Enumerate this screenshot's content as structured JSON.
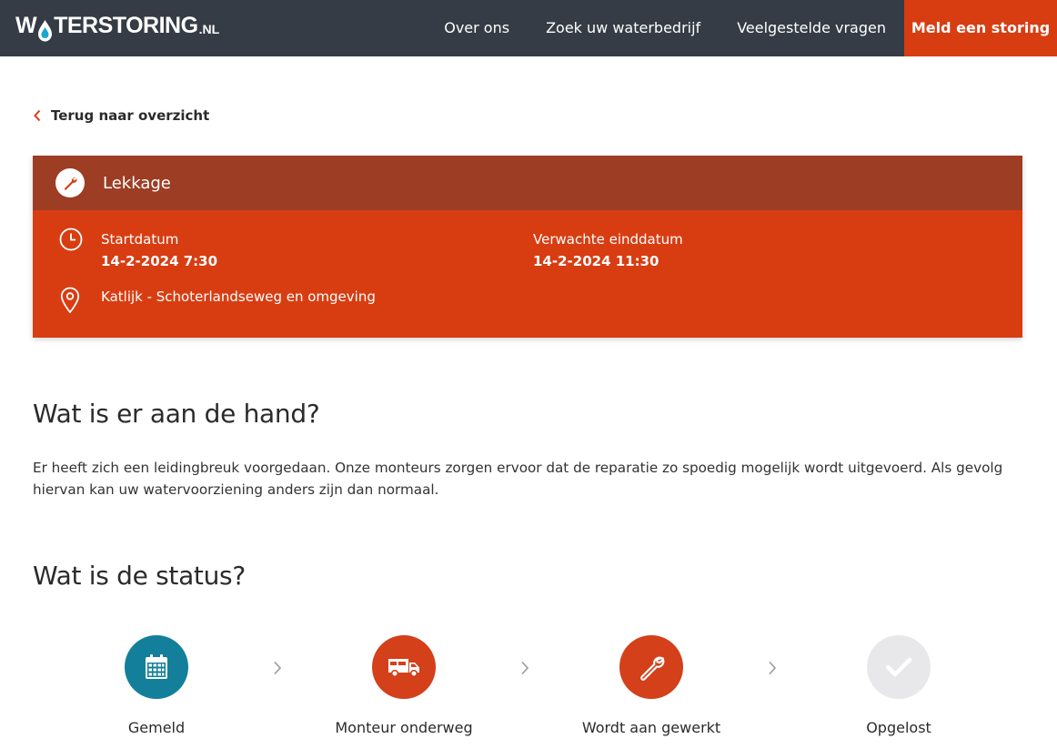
{
  "header": {
    "logo": {
      "part1": "W",
      "part2": "A",
      "part3": "TERSTORING",
      "suffix": ".NL"
    },
    "nav": [
      "Over ons",
      "Zoek uw waterbedrijf",
      "Veelgestelde vragen"
    ],
    "cta": "Meld een storing"
  },
  "back_link": "Terug naar overzicht",
  "incident": {
    "type": "Lekkage",
    "start_label": "Startdatum",
    "start_value": "14-2-2024 7:30",
    "end_label": "Verwachte einddatum",
    "end_value": "14-2-2024 11:30",
    "location": "Katlijk - Schoterlandseweg en omgeving"
  },
  "section1": {
    "heading": "Wat is er aan de hand?",
    "text": "Er heeft zich een leidingbreuk voorgedaan. Onze monteurs zorgen ervoor dat de reparatie zo spoedig mogelijk wordt uitgevoerd. Als gevolg hiervan kan uw watervoorziening anders zijn dan normaal."
  },
  "section2": {
    "heading": "Wat is de status?",
    "steps": [
      {
        "label": "Gemeld",
        "icon": "calendar-icon",
        "color": "#137f9b"
      },
      {
        "label": "Monteur onderweg",
        "icon": "van-icon",
        "color": "#d3401a"
      },
      {
        "label": "Wordt aan gewerkt",
        "icon": "wrench-icon",
        "color": "#d3401a"
      },
      {
        "label": "Opgelost",
        "icon": "check-icon",
        "color": "#e8e8ea"
      }
    ]
  },
  "colors": {
    "header_bg": "#353c45",
    "accent": "#d83d12",
    "card_head": "#9c3d24",
    "status_done": "#137f9b"
  }
}
